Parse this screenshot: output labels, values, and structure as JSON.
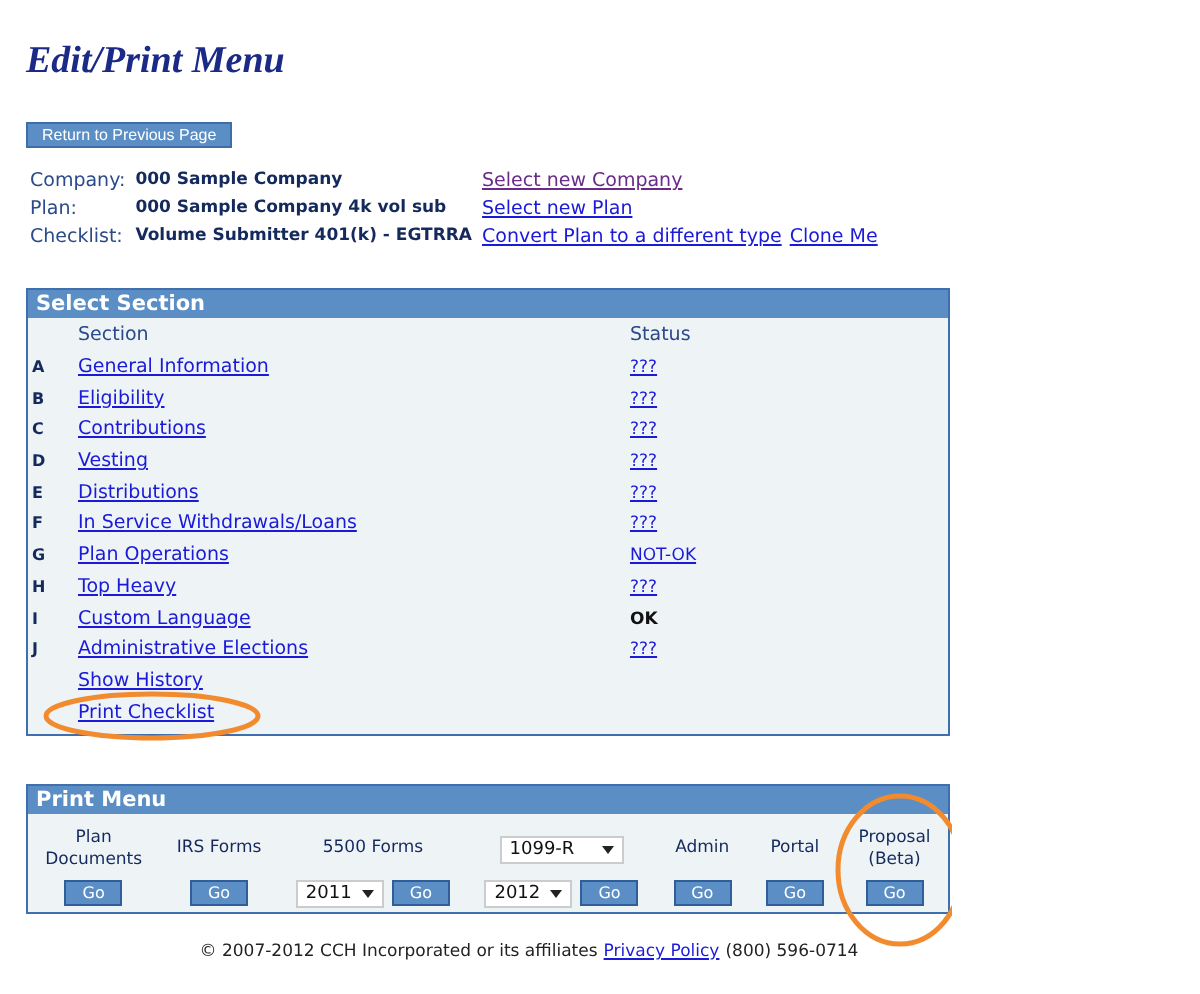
{
  "title": "Edit/Print Menu",
  "back_button": "Return to Previous Page",
  "info": [
    {
      "label": "Company:",
      "value": "000 Sample Company",
      "links": [
        {
          "text": "Select new Company",
          "visited": true
        }
      ]
    },
    {
      "label": "Plan:",
      "value": "000 Sample Company 4k vol sub",
      "links": [
        {
          "text": "Select new Plan",
          "visited": false
        }
      ]
    },
    {
      "label": "Checklist:",
      "value": "Volume Submitter 401(k) - EGTRRA",
      "links": [
        {
          "text": "Convert Plan to a different type",
          "visited": false
        },
        {
          "text": "Clone Me",
          "visited": false
        }
      ]
    }
  ],
  "select_section": {
    "title": "Select Section",
    "headers": [
      "Section",
      "Status"
    ],
    "rows": [
      {
        "letter": "A",
        "section": "General Information",
        "status": "???",
        "kind": "link"
      },
      {
        "letter": "B",
        "section": "Eligibility",
        "status": "???",
        "kind": "link"
      },
      {
        "letter": "C",
        "section": "Contributions",
        "status": "???",
        "kind": "link"
      },
      {
        "letter": "D",
        "section": "Vesting",
        "status": "???",
        "kind": "link"
      },
      {
        "letter": "E",
        "section": "Distributions",
        "status": "???",
        "kind": "link"
      },
      {
        "letter": "F",
        "section": "In Service Withdrawals/Loans",
        "status": "???",
        "kind": "link"
      },
      {
        "letter": "G",
        "section": "Plan Operations",
        "status": "NOT-OK",
        "kind": "link"
      },
      {
        "letter": "H",
        "section": "Top Heavy",
        "status": "???",
        "kind": "link"
      },
      {
        "letter": "I",
        "section": "Custom Language",
        "status": "OK",
        "kind": "text"
      },
      {
        "letter": "J",
        "section": "Administrative Elections",
        "status": "???",
        "kind": "link"
      }
    ],
    "extra_links": [
      {
        "text": "Show History",
        "circled": false
      },
      {
        "text": "Print Checklist",
        "circled": true
      }
    ]
  },
  "print_menu": {
    "title": "Print Menu",
    "columns": [
      {
        "label": [
          "Plan",
          "Documents"
        ],
        "button": "Go",
        "circled": false
      },
      {
        "label": [
          "IRS Forms"
        ],
        "button": "Go",
        "circled": false
      },
      {
        "label": [
          "5500 Forms"
        ],
        "year_select": "2011",
        "button": "Go",
        "circled": false
      },
      {
        "top_select": "1099-R",
        "year_select": "2012",
        "button": "Go",
        "circled": false
      },
      {
        "label": [
          "Admin"
        ],
        "button": "Go",
        "circled": false
      },
      {
        "label": [
          "Portal"
        ],
        "button": "Go",
        "circled": false
      },
      {
        "label": [
          "Proposal",
          "(Beta)"
        ],
        "button": "Go",
        "circled": true
      }
    ]
  },
  "footer": {
    "copyright": "© 2007-2012 CCH Incorporated or its affiliates",
    "link": "Privacy Policy",
    "phone": "(800) 596-0714"
  }
}
